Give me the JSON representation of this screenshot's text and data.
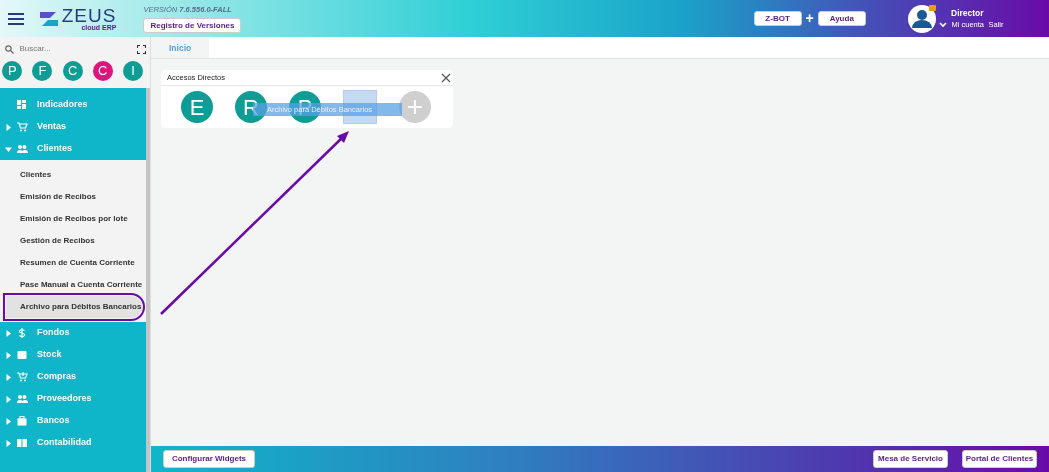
{
  "header": {
    "version_label": "VERSIÓN",
    "version": "7.6.556.0-FALL",
    "logo_text": "ZEUS",
    "logo_sub": "cloud ERP",
    "release_button": "Registro de Versiones",
    "buttons": [
      {
        "label": "Z-BOT"
      },
      {
        "label": "+",
        "kind": "plus"
      },
      {
        "label": "Ayuda"
      }
    ],
    "user": {
      "name": "Director",
      "links": [
        "Mi cuenta",
        "Salir"
      ]
    }
  },
  "sidebar": {
    "search_placeholder": "Buscar...",
    "favorites": [
      {
        "letter": "P",
        "color": "#0d9d94"
      },
      {
        "letter": "F",
        "color": "#0d9d94"
      },
      {
        "letter": "C",
        "color": "#0d9d94"
      },
      {
        "letter": "C",
        "color": "#e0147c"
      },
      {
        "letter": "I",
        "color": "#0d9d94"
      }
    ],
    "items": [
      {
        "label": "Indicadores",
        "expandable": false
      },
      {
        "label": "Ventas",
        "expandable": true,
        "expanded": false
      },
      {
        "label": "Clientes",
        "expandable": true,
        "expanded": true,
        "children": [
          {
            "label": "Clientes",
            "selected": false,
            "highlighted": false
          },
          {
            "label": "Emisión de Recibos",
            "selected": false,
            "highlighted": false
          },
          {
            "label": "Emisión de Recibos por lote",
            "selected": false,
            "highlighted": false
          },
          {
            "label": "Gestión de Recibos",
            "selected": false,
            "highlighted": false
          },
          {
            "label": "Resumen de Cuenta Corriente",
            "selected": false,
            "highlighted": false
          },
          {
            "label": "Pase Manual a Cuenta Corriente",
            "selected": false,
            "highlighted": false
          },
          {
            "label": "Archivo para Débitos Bancarios",
            "selected": true,
            "highlighted": true
          }
        ]
      },
      {
        "label": "Fondos",
        "expandable": true,
        "expanded": false
      },
      {
        "label": "Stock",
        "expandable": true,
        "expanded": false
      },
      {
        "label": "Compras",
        "expandable": true,
        "expanded": false
      },
      {
        "label": "Proveedores",
        "expandable": true,
        "expanded": false
      },
      {
        "label": "Bancos",
        "expandable": true,
        "expanded": false
      },
      {
        "label": "Contabilidad",
        "expandable": true,
        "expanded": false
      }
    ]
  },
  "tabs": [
    {
      "label": "Inicio",
      "selected": true
    }
  ],
  "widget": {
    "title": "Accesos Directos",
    "shortcuts": [
      {
        "kind": "letter",
        "letter": "E"
      },
      {
        "kind": "letter",
        "letter": "R"
      },
      {
        "kind": "letter",
        "letter": "P"
      },
      {
        "kind": "drop"
      },
      {
        "kind": "add",
        "letter": "+"
      }
    ],
    "drag_label": "Archivo para Débitos Bancarios"
  },
  "footer": {
    "left_button": "Configurar Widgets",
    "right_buttons": [
      "Mesa de Servicio",
      "Portal de Clientes"
    ]
  }
}
